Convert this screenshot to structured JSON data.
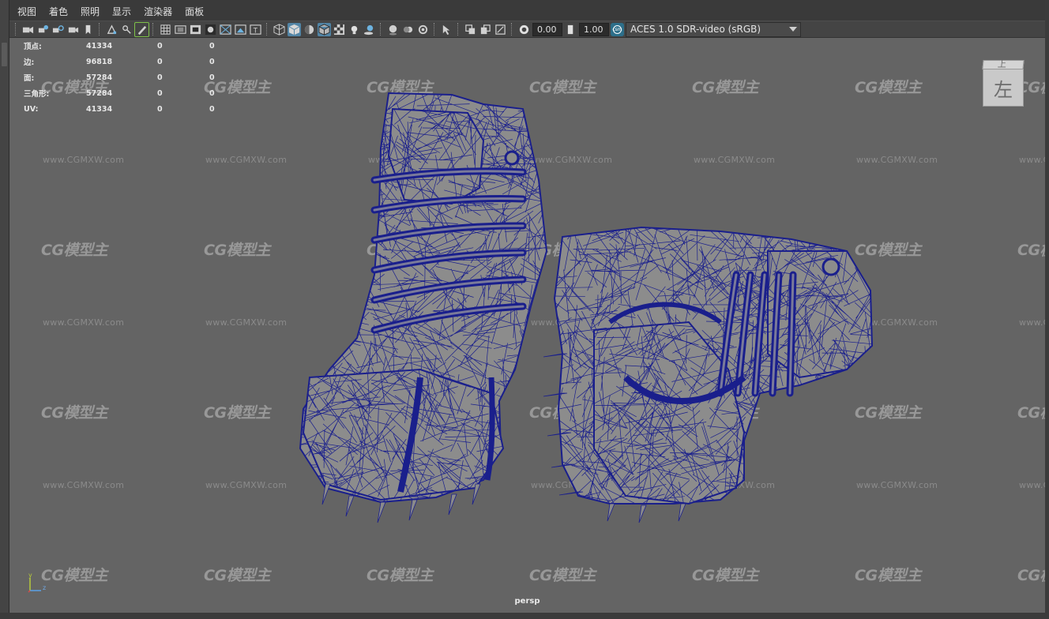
{
  "menu": [
    "视图",
    "着色",
    "照明",
    "显示",
    "渲染器",
    "面板"
  ],
  "toolbar": {
    "exposure": "0.00",
    "gamma": "1.00",
    "color_space": "ACES 1.0 SDR-video (sRGB)",
    "icons_group1": [
      "camera-select-icon",
      "camera-attributes-icon",
      "bookmark-camera-icon",
      "image-plane-icon",
      "bookmark-icon",
      "2d-pan-zoom-icon",
      "grease-pencil-icon"
    ],
    "icons_group2": [
      "grid-icon",
      "film-gate-icon",
      "resolution-gate-icon",
      "gate-mask-icon",
      "field-chart-icon",
      "safe-action-icon",
      "safe-title-icon"
    ],
    "icons_group3": [
      "wireframe-icon",
      "smooth-shade-icon",
      "default-material-icon",
      "wireframe-on-shaded-icon",
      "textured-icon",
      "use-all-lights-icon",
      "shadows-icon"
    ],
    "icons_group4": [
      "screen-space-ao-icon",
      "motion-blur-icon",
      "anti-aliasing-icon",
      "depth-of-field-icon"
    ],
    "icons_group5": [
      "isolate-select-icon",
      "xray-icon",
      "xray-active-icon",
      "xray-joints-icon",
      "backface-culling-icon"
    ]
  },
  "hud": {
    "rows": [
      {
        "label": "顶点:",
        "total": "41334",
        "selected": "0",
        "component": "0"
      },
      {
        "label": "边:",
        "total": "96818",
        "selected": "0",
        "component": "0"
      },
      {
        "label": "面:",
        "total": "57284",
        "selected": "0",
        "component": "0"
      },
      {
        "label": "三角形:",
        "total": "57284",
        "selected": "0",
        "component": "0"
      },
      {
        "label": "UV:",
        "total": "41334",
        "selected": "0",
        "component": "0"
      }
    ]
  },
  "viewcube": {
    "face": "左",
    "top": "上"
  },
  "watermark": {
    "logo": "CG模型主",
    "url": "www.CGMXW.com"
  },
  "axis": {
    "y": "y",
    "z": "z"
  },
  "camera_label": "persp",
  "colors": {
    "wireframe": "#1a1f8c",
    "mesh": "#8c8c8c",
    "viewport_bg": "#646464"
  }
}
